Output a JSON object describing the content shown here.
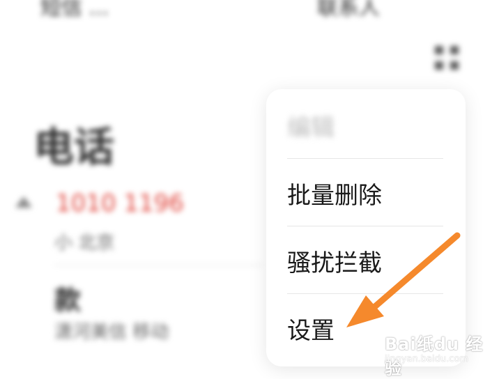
{
  "background": {
    "top_left": "短信 ...",
    "top_right": "联系人",
    "title": "电话",
    "call_1_number": "1010 1196",
    "call_1_sub": "小 北京",
    "call_2_name": "款",
    "call_2_sub": "潇河美信 移动"
  },
  "menu": {
    "items": [
      {
        "label": "编辑"
      },
      {
        "label": "批量删除"
      },
      {
        "label": "骚扰拦截"
      },
      {
        "label": "设置"
      }
    ]
  },
  "annotation": {
    "arrow_color": "#F5892C",
    "missed_call_color": "#E0453C"
  },
  "watermark": {
    "logo": "Bai纸du 经验",
    "url": "jingyan.baidu.com"
  }
}
